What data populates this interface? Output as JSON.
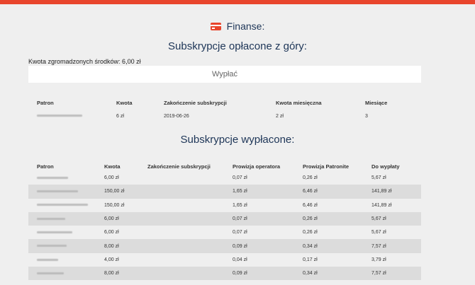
{
  "header": {
    "title": "Finanse:",
    "icon": "credit-card-icon",
    "accent": "#e8452c"
  },
  "prepaid": {
    "title": "Subskrypcje opłacone z góry:",
    "balance_label": "Kwota zgromadzonych środków: 6,00 zł",
    "withdraw_label": "Wypłać",
    "columns": [
      "Patron",
      "Kwota",
      "Zakończenie subskrypcji",
      "Kwota miesięczna",
      "Miesiące"
    ],
    "rows": [
      {
        "amount": "6 zł",
        "end": "2019-06-26",
        "monthly": "2 zł",
        "months": "3"
      }
    ]
  },
  "paid": {
    "title": "Subskrypcje wypłacone:",
    "columns": [
      "Patron",
      "Kwota",
      "Zakończenie subskrypcji",
      "Prowizja operatora",
      "Prowizja Patronite",
      "Do wypłaty"
    ],
    "rows": [
      {
        "amount": "6,00 zł",
        "end": "",
        "op": "0,07 zł",
        "pat": "0,26 zł",
        "payout": "5,67 zł"
      },
      {
        "amount": "150,00 zł",
        "end": "",
        "op": "1,65 zł",
        "pat": "6,46 zł",
        "payout": "141,89 zł"
      },
      {
        "amount": "150,00 zł",
        "end": "",
        "op": "1,65 zł",
        "pat": "6,46 zł",
        "payout": "141,89 zł"
      },
      {
        "amount": "6,00 zł",
        "end": "",
        "op": "0,07 zł",
        "pat": "0,26 zł",
        "payout": "5,67 zł"
      },
      {
        "amount": "6,00 zł",
        "end": "",
        "op": "0,07 zł",
        "pat": "0,26 zł",
        "payout": "5,67 zł"
      },
      {
        "amount": "8,00 zł",
        "end": "",
        "op": "0,09 zł",
        "pat": "0,34 zł",
        "payout": "7,57 zł"
      },
      {
        "amount": "4,00 zł",
        "end": "",
        "op": "0,04 zł",
        "pat": "0,17 zł",
        "payout": "3,79 zł"
      },
      {
        "amount": "8,00 zł",
        "end": "",
        "op": "0,09 zł",
        "pat": "0,34 zł",
        "payout": "7,57 zł"
      }
    ]
  }
}
